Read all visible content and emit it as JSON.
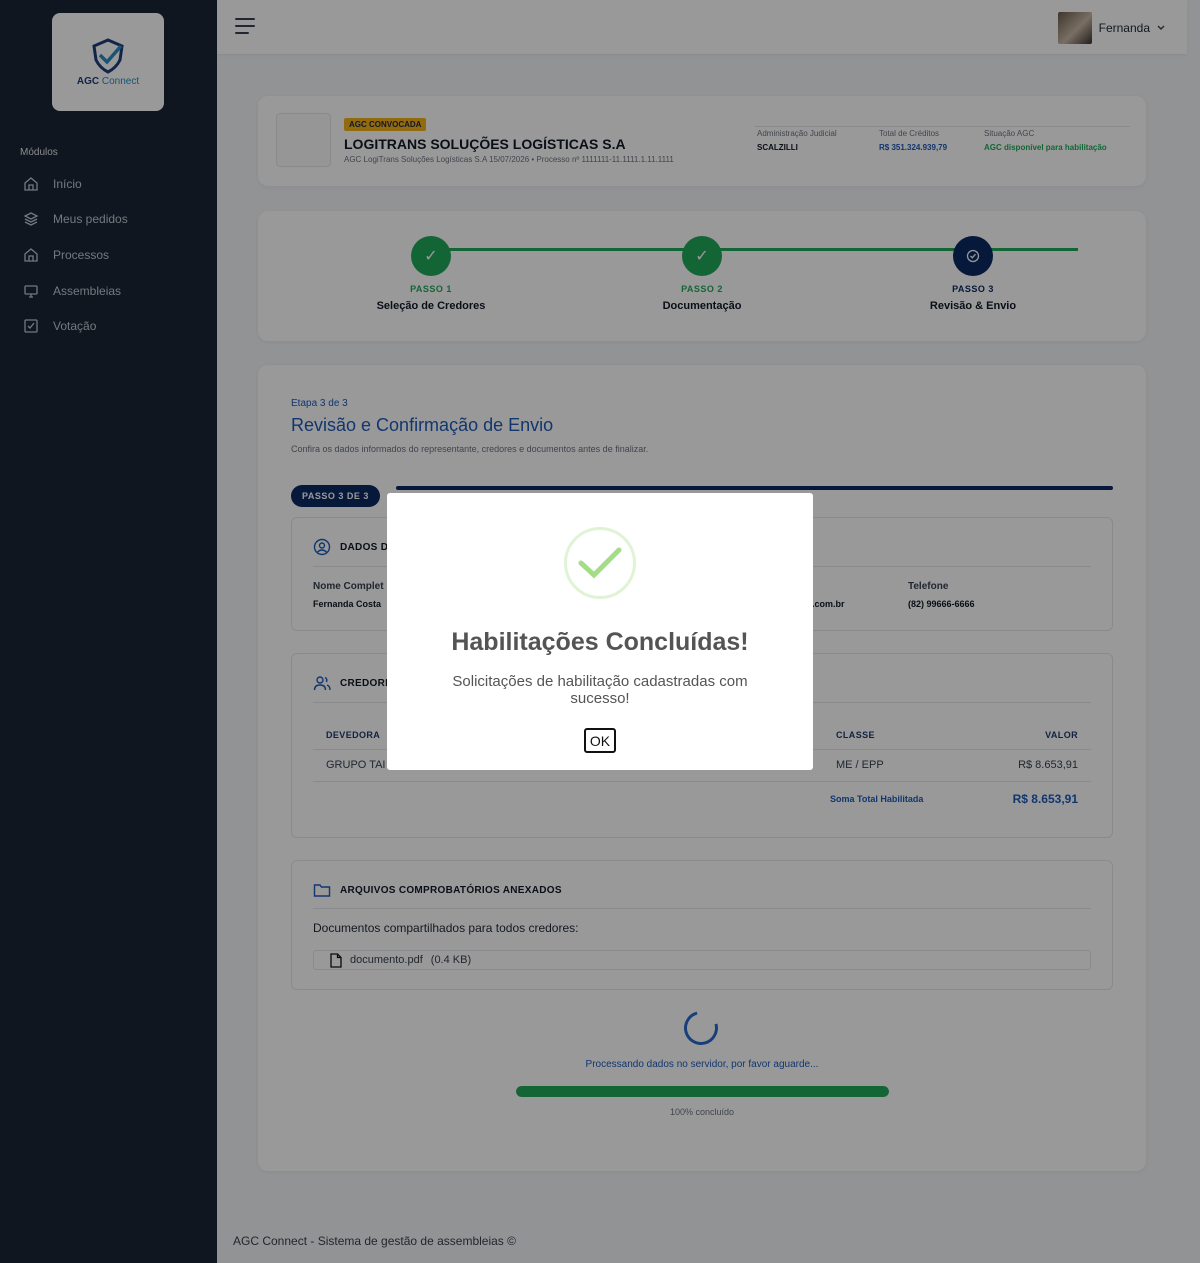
{
  "sidebar": {
    "logo_text_1": "AGC",
    "logo_text_2": "Connect",
    "modules_label": "Módulos",
    "items": [
      {
        "label": "Início",
        "icon": "home-icon"
      },
      {
        "label": "Meus pedidos",
        "icon": "layers-icon"
      },
      {
        "label": "Processos",
        "icon": "home-icon"
      },
      {
        "label": "Assembleias",
        "icon": "monitor-icon"
      },
      {
        "label": "Votação",
        "icon": "check-square-icon"
      }
    ]
  },
  "topbar": {
    "user_name": "Fernanda"
  },
  "company": {
    "badge": "AGC CONVOCADA",
    "name": "LOGITRANS SOLUÇÕES LOGÍSTICAS S.A",
    "subtitle": "AGC LogiTrans Soluções Logísticas S.A 15/07/2026 • Processo nº 1111111-11.1111.1.11.1111",
    "admin_label": "Administração Judicial",
    "admin_value": "SCALZILLI",
    "credits_label": "Total de Créditos",
    "credits_value": "R$ 351.324.939,79",
    "status_label": "Situação AGC",
    "status_value": "AGC disponível para habilitação"
  },
  "steps": [
    {
      "label": "PASSO 1",
      "name": "Seleção de Credores",
      "status": "done"
    },
    {
      "label": "PASSO 2",
      "name": "Documentação",
      "status": "done"
    },
    {
      "label": "PASSO 3",
      "name": "Revisão & Envio",
      "status": "current"
    }
  ],
  "main": {
    "etapa": "Etapa 3 de 3",
    "title": "Revisão e Confirmação de Envio",
    "subtitle": "Confira os dados informados do representante, credores e documentos antes de finalizar.",
    "pill": "PASSO 3 DE 3",
    "dados": {
      "title": "DADOS D",
      "name_label": "Nome Complet",
      "name_value": "Fernanda Costa",
      "email_value_fragment": ".com.br",
      "phone_label": "Telefone",
      "phone_value": "(82) 99666-6666"
    },
    "credores": {
      "title": "CREDORE",
      "col_devedora": "DEVEDORA",
      "col_classe": "CLASSE",
      "col_valor": "VALOR",
      "row_devedora": "GRUPO TAI",
      "row_classe": "ME / EPP",
      "row_valor": "R$ 8.653,91",
      "total_label": "Soma Total Habilitada",
      "total_value": "R$ 8.653,91"
    },
    "arquivos": {
      "title": "ARQUIVOS COMPROBATÓRIOS ANEXADOS",
      "shared_label": "Documentos compartilhados para todos credores:",
      "file_name": "documento.pdf",
      "file_size": "(0.4 KB)"
    },
    "processing_text": "Processando dados no servidor, por favor aguarde...",
    "progress_percent": 100,
    "progress_text": "100% concluído"
  },
  "footer": {
    "text": "AGC Connect - Sistema de gestão de assembleias ©"
  },
  "modal": {
    "title": "Habilitações Concluídas!",
    "text": "Solicitações de habilitação cadastradas com sucesso!",
    "ok_label": "OK"
  },
  "colors": {
    "sidebar_bg": "#1b2535",
    "primary_blue": "#1e5bb8",
    "navy": "#0b2a63",
    "green": "#22a95b",
    "badge_yellow": "#f3b21b"
  }
}
